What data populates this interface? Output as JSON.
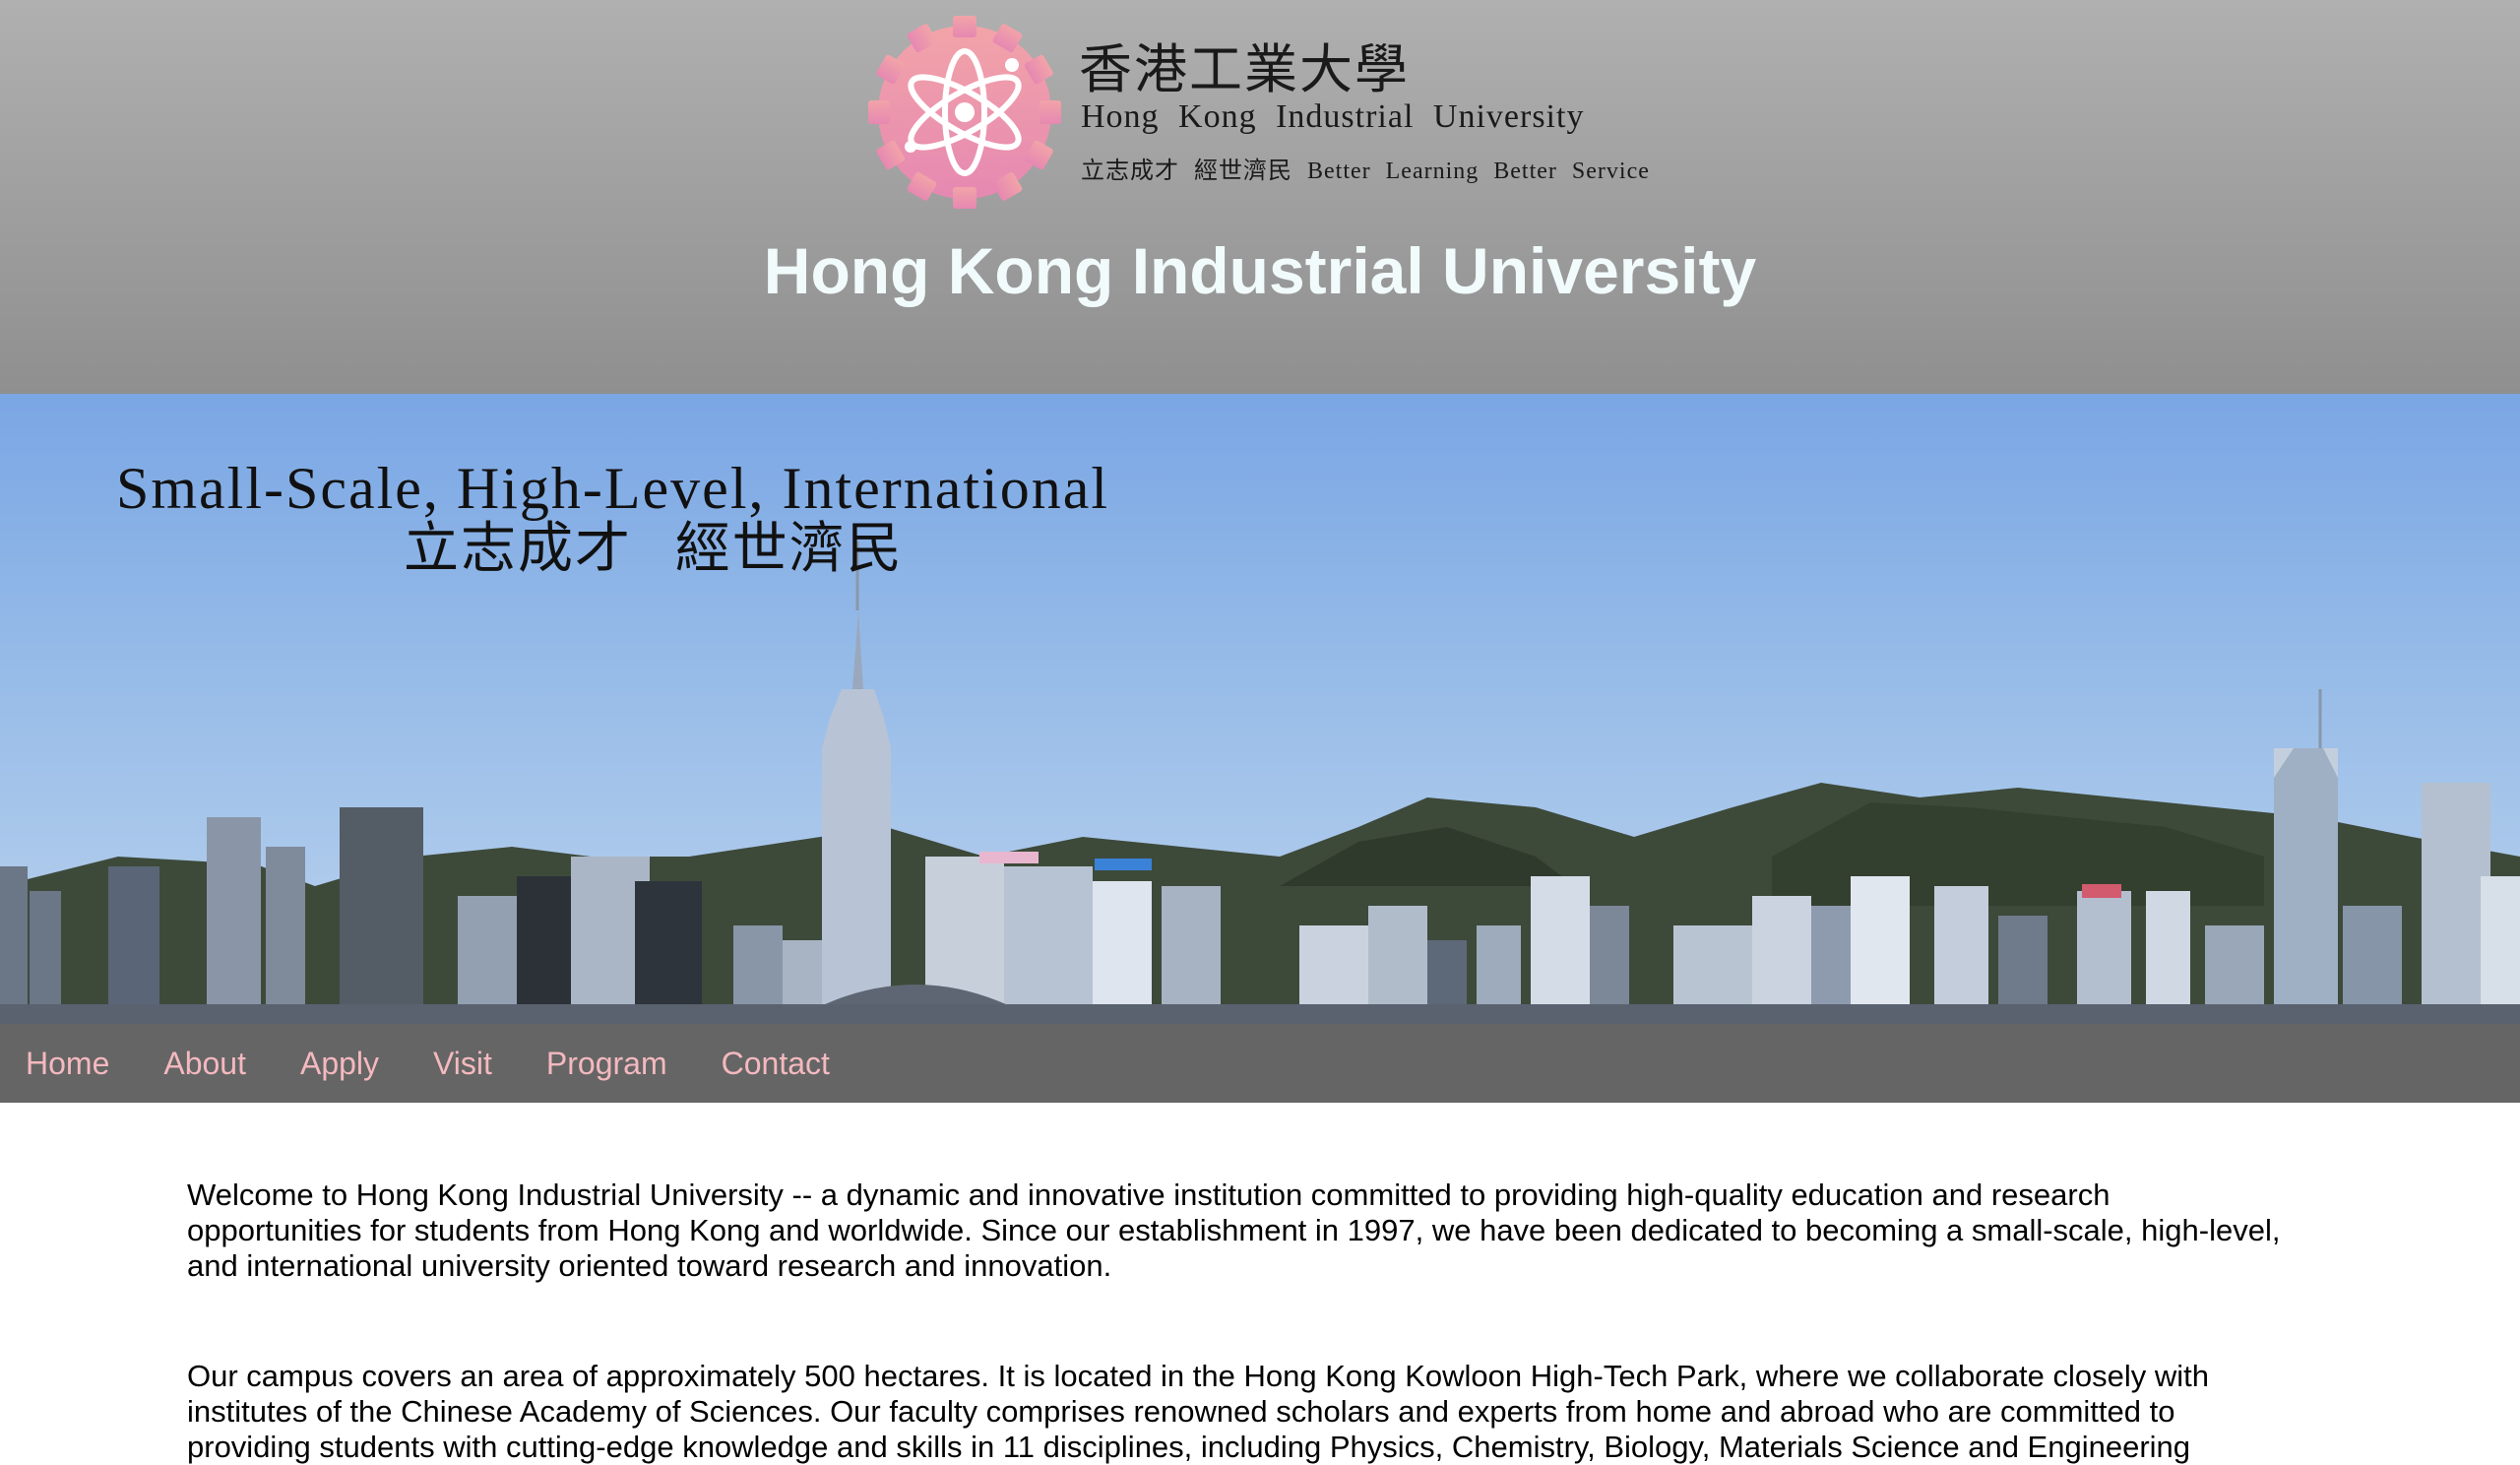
{
  "header": {
    "logo_chinese": "香港工業大學",
    "logo_english": "Hong Kong Industrial University",
    "logo_motto": "立志成才 經世濟民 Better Learning Better Service",
    "site_title": "Hong Kong Industrial University",
    "logo_icon": "atom-gear-icon"
  },
  "banner": {
    "line1": "Small-Scale, High-Level, International",
    "line2": "立志成才 經世濟民",
    "image": "hong-kong-skyline-image"
  },
  "nav": {
    "items": [
      {
        "label": "Home"
      },
      {
        "label": "About"
      },
      {
        "label": "Apply"
      },
      {
        "label": "Visit"
      },
      {
        "label": "Program"
      },
      {
        "label": "Contact"
      }
    ]
  },
  "content": {
    "paragraphs": [
      "Welcome to Hong Kong Industrial University -- a dynamic and innovative institution committed to providing high-quality education and research opportunities for students from Hong Kong and worldwide. Since our establishment in 1997, we have been dedicated to becoming a small-scale, high-level, and international university oriented toward research and innovation.",
      "Our campus covers an area of approximately 500 hectares. It is located in the Hong Kong Kowloon High-Tech Park, where we collaborate closely with institutes of the Chinese Academy of Sciences. Our faculty comprises renowned scholars and experts from home and abroad who are committed to providing students with cutting-edge knowledge and skills in 11 disciplines, including Physics, Chemistry, Biology, Materials Science and Engineering"
    ]
  },
  "colors": {
    "header_top": "#b0b0b0",
    "header_bottom": "#8f8f8f",
    "title_text": "#f2fbfb",
    "nav_background": "#656565",
    "nav_link": "#f4b9bf",
    "logo_pink": "#ec8fae"
  }
}
